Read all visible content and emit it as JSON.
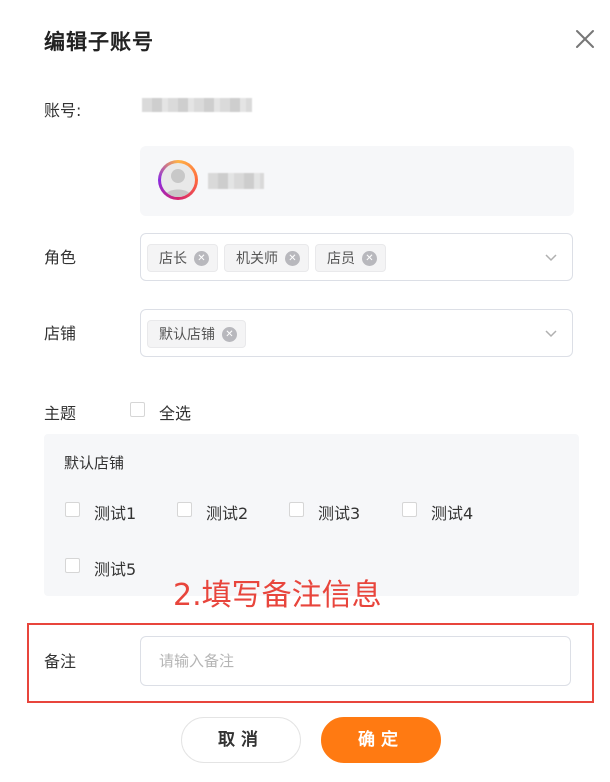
{
  "dialog": {
    "title": "编辑子账号"
  },
  "account": {
    "label": "账号:",
    "value_obscured": true
  },
  "role": {
    "label": "角色",
    "tags": [
      "店长",
      "机关师",
      "店员"
    ]
  },
  "store": {
    "label": "店铺",
    "tags": [
      "默认店铺"
    ]
  },
  "theme": {
    "label": "主题",
    "select_all": "全选",
    "group_title": "默认店铺",
    "options": [
      "测试1",
      "测试2",
      "测试3",
      "测试4",
      "测试5"
    ]
  },
  "annotation": {
    "text": "2.填写备注信息",
    "color": "#e8453c"
  },
  "remark": {
    "label": "备注",
    "placeholder": "请输入备注",
    "value": ""
  },
  "buttons": {
    "cancel": "取消",
    "confirm": "确定"
  },
  "colors": {
    "accent": "#ff7a12",
    "highlight": "#e8453c"
  },
  "icons": [
    "close-icon",
    "avatar-icon",
    "tag-close-icon",
    "chevron-down-icon",
    "checkbox-icon"
  ]
}
